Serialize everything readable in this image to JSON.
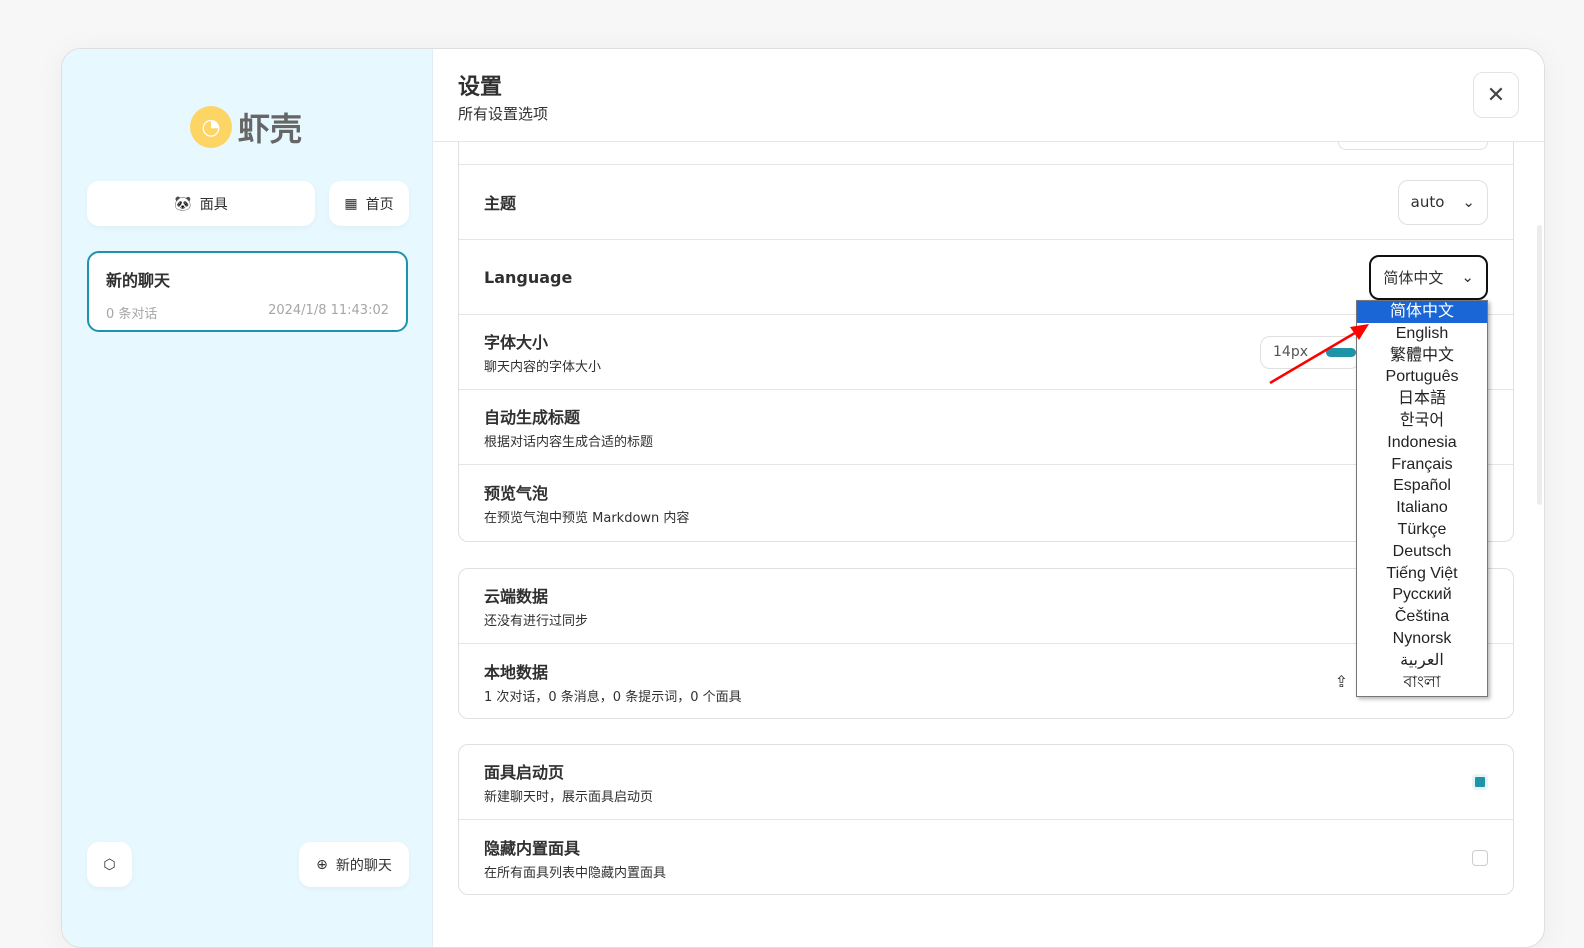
{
  "sidebar": {
    "logo_text": "虾壳",
    "mask_button": "面具",
    "home_button": "首页",
    "chat": {
      "title": "新的聊天",
      "count": "0 条对话",
      "time": "2024/1/8 11:43:02"
    },
    "new_chat_button": "新的聊天"
  },
  "header": {
    "title": "设置",
    "subtitle": "所有设置选项"
  },
  "settings": {
    "theme": {
      "title": "主题",
      "value": "auto"
    },
    "language": {
      "title": "Language",
      "value": "简体中文",
      "options": [
        "简体中文",
        "English",
        "繁體中文",
        "Português",
        "日本語",
        "한국어",
        "Indonesia",
        "Français",
        "Español",
        "Italiano",
        "Türkçe",
        "Deutsch",
        "Tiếng Việt",
        "Русский",
        "Čeština",
        "Nynorsk",
        "العربية",
        "বাংলা"
      ]
    },
    "font_size": {
      "title": "字体大小",
      "desc": "聊天内容的字体大小",
      "value": "14px"
    },
    "auto_title": {
      "title": "自动生成标题",
      "desc": "根据对话内容生成合适的标题"
    },
    "preview": {
      "title": "预览气泡",
      "desc": "在预览气泡中预览 Markdown 内容"
    },
    "cloud": {
      "title": "云端数据",
      "desc": "还没有进行过同步"
    },
    "local": {
      "title": "本地数据",
      "desc": "1 次对话，0 条消息，0 条提示词，0 个面具"
    },
    "mask_splash": {
      "title": "面具启动页",
      "desc": "新建聊天时，展示面具启动页",
      "checked": true
    },
    "hide_builtin": {
      "title": "隐藏内置面具",
      "desc": "在所有面具列表中隐藏内置面具",
      "checked": false
    }
  },
  "colors": {
    "accent": "#1f94a8",
    "sidebar_bg": "#e7f8ff",
    "dropdown_selected": "#1a66d6",
    "annotation_arrow": "#ff0000"
  }
}
